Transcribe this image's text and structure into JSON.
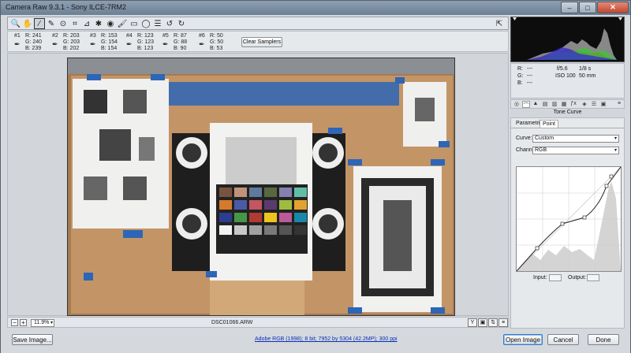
{
  "window": {
    "title": "Camera Raw 9.3.1  -  Sony ILCE-7RM2",
    "minimize": "–",
    "maximize": "□",
    "close": "✕"
  },
  "toolbar": {
    "tools": [
      "zoom-icon",
      "hand-icon",
      "white-balance-icon",
      "color-sampler-icon",
      "targeted-adjust-icon",
      "crop-icon",
      "straighten-icon",
      "spot-removal-icon",
      "red-eye-icon",
      "adjustment-brush-icon",
      "graduated-filter-icon",
      "radial-filter-icon",
      "preferences-icon",
      "rotate-ccw-icon",
      "rotate-cw-icon"
    ],
    "glyphs": [
      "🔍",
      "✋",
      "⁄",
      "✎",
      "⊙",
      "⌗",
      "⊿",
      "✱",
      "◉",
      "🖌",
      "▭",
      "◯",
      "☰",
      "↺",
      "↻"
    ]
  },
  "samplers": [
    {
      "num": "#1",
      "r": "R: 241",
      "g": "G: 240",
      "b": "B: 239"
    },
    {
      "num": "#2",
      "r": "R: 203",
      "g": "G: 203",
      "b": "B: 202"
    },
    {
      "num": "#3",
      "r": "R: 153",
      "g": "G: 154",
      "b": "B: 154"
    },
    {
      "num": "#4",
      "r": "R: 123",
      "g": "G: 123",
      "b": "B: 123"
    },
    {
      "num": "#5",
      "r": "R: 87",
      "g": "G: 88",
      "b": "B: 90"
    },
    {
      "num": "#6",
      "r": "R: 50",
      "g": "G: 50",
      "b": "B: 53"
    }
  ],
  "clear_samplers": "Clear Samplers",
  "status": {
    "zoom": "11.9%",
    "filename": "DSC01066.ARW"
  },
  "bottom": {
    "save": "Save Image...",
    "workflow_link": "Adobe RGB (1998); 8 bit; 7952 by 5304 (42.2MP); 300 ppi",
    "open": "Open Image",
    "cancel": "Cancel",
    "done": "Done"
  },
  "info": {
    "r_label": "R:",
    "g_label": "G:",
    "b_label": "B:",
    "dash": "---",
    "aperture": "f/5.6",
    "shutter": "1/8 s",
    "iso": "ISO 100",
    "focal": "50 mm"
  },
  "panel": {
    "title": "Tone Curve",
    "tab_parametric": "Parametric",
    "tab_point": "Point",
    "curve_label": "Curve:",
    "curve_value": "Custom",
    "channel_label": "Channel:",
    "channel_value": "RGB",
    "input_label": "Input:",
    "output_label": "Output:"
  },
  "colors": {
    "accent": "#3b78c3",
    "tape": "#2d66b6",
    "board": "#c39566"
  }
}
